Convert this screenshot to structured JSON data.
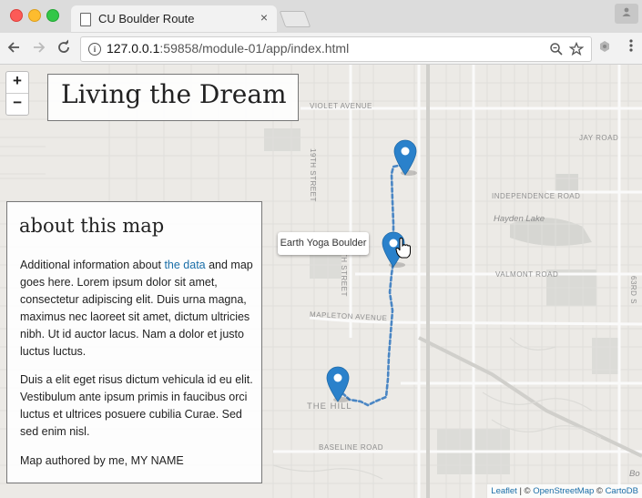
{
  "browser": {
    "tab_title": "CU Boulder Route",
    "tab_close": "×",
    "url_host": "127.0.0.1",
    "url_rest": ":59858/module-01/app/index.html"
  },
  "map": {
    "zoom_in": "+",
    "zoom_out": "−",
    "title": "Living the Dream",
    "about": {
      "heading": "about this map",
      "p1_before": "Additional information about ",
      "p1_link": "the data",
      "p1_after": " and map goes here. Lorem ipsum dolor sit amet, consectetur adipiscing elit. Duis urna magna, maximus nec laoreet sit amet, dictum ultricies nibh. Ut id auctor lacus. Nam a dolor et justo luctus luctus.",
      "p2": "Duis a elit eget risus dictum vehicula id eu elit. Vestibulum ante ipsum primis in faucibus orci luctus et ultrices posuere cubilia Curae. Sed sed enim nisl.",
      "author": "Map authored by me, MY NAME"
    },
    "tooltip": "Earth Yoga Boulder",
    "labels": {
      "violet": "VIOLET AVENUE",
      "jay": "JAY ROAD",
      "independence": "INDEPENDENCE ROAD",
      "hayden": "Hayden Lake",
      "valmont": "VALMONT ROAD",
      "mapleton": "MAPLETON AVENUE",
      "the_hill": "THE HILL",
      "baseline": "BASELINE ROAD",
      "street19": "19TH STREET",
      "street26": "26TH STREET",
      "street63": "63RD S",
      "bo": "Bo"
    },
    "attribution": {
      "leaflet": "Leaflet",
      "sep1": " | © ",
      "osm": "OpenStreetMap",
      "sep2": " © ",
      "carto": "CartoDB"
    },
    "colors": {
      "route": "#4a86c4",
      "marker": "#2a81cb"
    }
  }
}
